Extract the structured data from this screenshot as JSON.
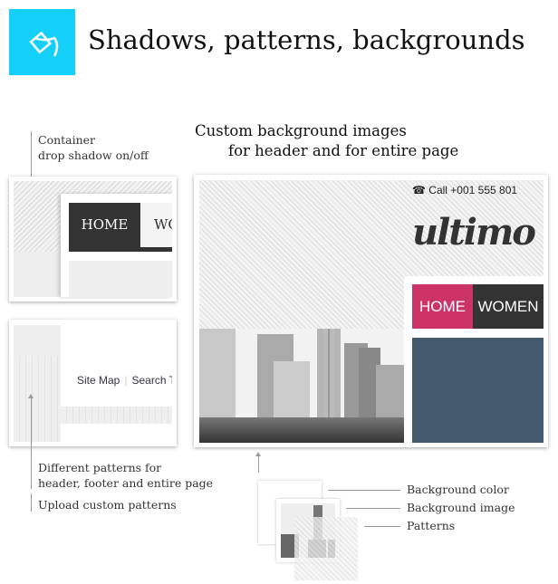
{
  "header": {
    "title": "Shadows, patterns, backgrounds",
    "icon": "paint-bucket-icon",
    "accent": "#14CFF8"
  },
  "annotations": {
    "container_shadow": [
      "Container",
      "drop shadow on/off"
    ],
    "patterns": [
      "Different patterns for",
      "header, footer and entire page"
    ],
    "upload": "Upload custom patterns",
    "custom_bg": [
      "Custom background images",
      "for header and for entire page"
    ],
    "layers": [
      "Background color",
      "Background image",
      "Patterns"
    ]
  },
  "preview1": {
    "nav": [
      "HOME",
      "WO"
    ]
  },
  "preview2": {
    "links": [
      "Site Map",
      "Search T"
    ]
  },
  "preview3": {
    "phone_icon": "phone-icon",
    "phone": "Call +001 555 801",
    "logo": "ultimo th",
    "nav": [
      "HOME",
      "WOMEN"
    ],
    "nav_active_color": "#CC3366",
    "block_color": "#445A6E"
  }
}
